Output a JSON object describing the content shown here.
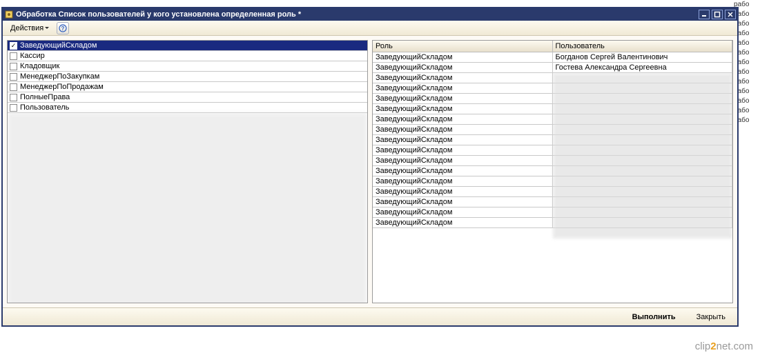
{
  "window": {
    "title": "Обработка  Список пользователей у кого установлена определенная роль *"
  },
  "toolbar": {
    "actions": "Действия"
  },
  "roles": [
    {
      "label": "ЗаведующийСкладом",
      "checked": true,
      "selected": true
    },
    {
      "label": "Кассир",
      "checked": false,
      "selected": false
    },
    {
      "label": "Кладовщик",
      "checked": false,
      "selected": false
    },
    {
      "label": "МенеджерПоЗакупкам",
      "checked": false,
      "selected": false
    },
    {
      "label": "МенеджерПоПродажам",
      "checked": false,
      "selected": false
    },
    {
      "label": "ПолныеПрава",
      "checked": false,
      "selected": false
    },
    {
      "label": "Пользователь",
      "checked": false,
      "selected": false
    }
  ],
  "table": {
    "headers": {
      "role": "Роль",
      "user": "Пользователь"
    },
    "rows": [
      {
        "role": "ЗаведующийСкладом",
        "user": "Богданов Сергей Валентинович"
      },
      {
        "role": "ЗаведующийСкладом",
        "user": "Гостева Александра Сергеевна"
      },
      {
        "role": "ЗаведующийСкладом",
        "user": ""
      },
      {
        "role": "ЗаведующийСкладом",
        "user": ""
      },
      {
        "role": "ЗаведующийСкладом",
        "user": ""
      },
      {
        "role": "ЗаведующийСкладом",
        "user": ""
      },
      {
        "role": "ЗаведующийСкладом",
        "user": ""
      },
      {
        "role": "ЗаведующийСкладом",
        "user": ""
      },
      {
        "role": "ЗаведующийСкладом",
        "user": ""
      },
      {
        "role": "ЗаведующийСкладом",
        "user": ""
      },
      {
        "role": "ЗаведующийСкладом",
        "user": ""
      },
      {
        "role": "ЗаведующийСкладом",
        "user": ""
      },
      {
        "role": "ЗаведующийСкладом",
        "user": ""
      },
      {
        "role": "ЗаведующийСкладом",
        "user": ""
      },
      {
        "role": "ЗаведующийСкладом",
        "user": ""
      },
      {
        "role": "ЗаведующийСкладом",
        "user": ""
      },
      {
        "role": "ЗаведующийСкладом",
        "user": ""
      }
    ]
  },
  "footer": {
    "execute": "Выполнить",
    "close": "Закрыть"
  },
  "bg_text": "рабо",
  "watermark": {
    "pre": "clip",
    "num": "2",
    "post": "net",
    "dom": ".com"
  }
}
